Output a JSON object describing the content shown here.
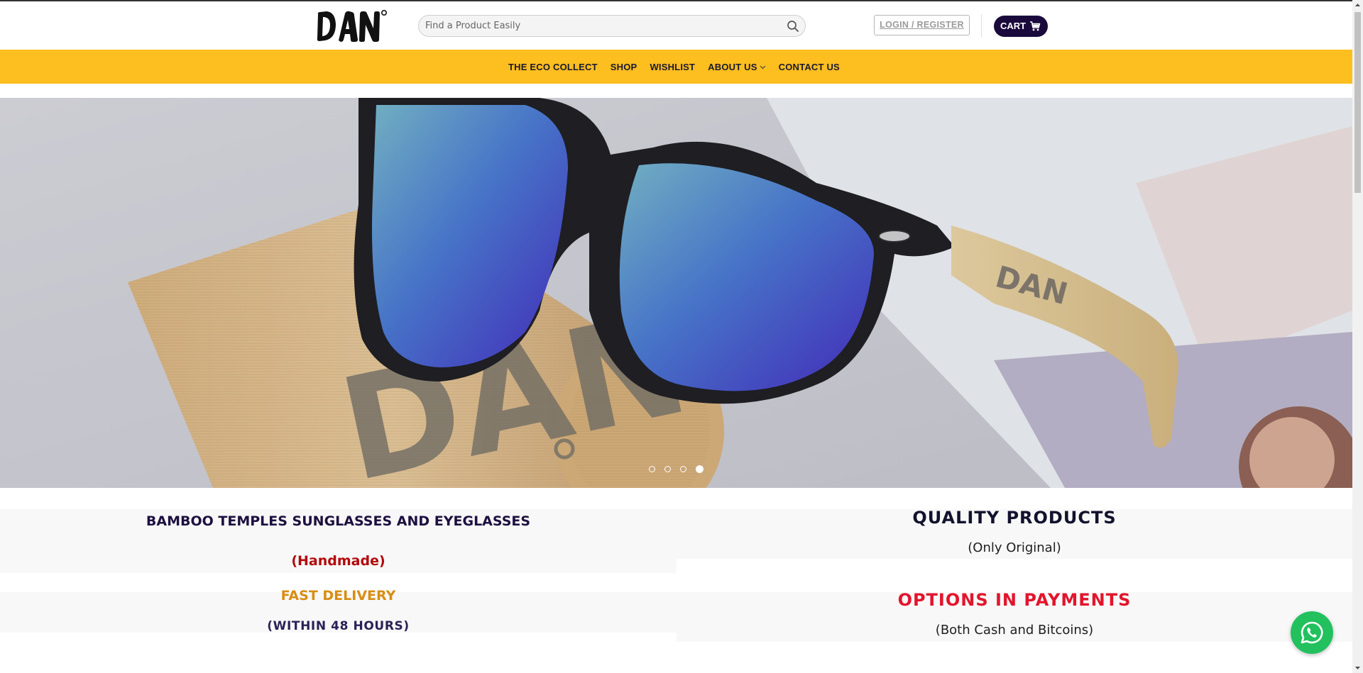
{
  "header": {
    "logo_text": "DAN°",
    "search": {
      "placeholder": "Find a Product Easily",
      "icon": "search-icon"
    },
    "login_label": "LOGIN / REGISTER",
    "cart_label": "CART",
    "cart_icon": "cart-icon"
  },
  "nav": {
    "items": [
      {
        "label": "THE ECO COLLECT"
      },
      {
        "label": "SHOP"
      },
      {
        "label": "WISHLIST"
      },
      {
        "label": "ABOUT US",
        "icon": "chevron-down-icon"
      },
      {
        "label": "CONTACT US"
      }
    ]
  },
  "hero": {
    "image_logo_text": "DAN°",
    "slides_count": 4,
    "active_slide": 4
  },
  "features": {
    "left": {
      "title": "BAMBOO TEMPLES SUNGLASSES AND EYEGLASSES",
      "subtitle": "(Handmade)",
      "delivery_title": "FAST DELIVERY",
      "delivery_subtitle": "(WITHIN 48 HOURS)"
    },
    "right": {
      "quality_title": "QUALITY PRODUCTS",
      "quality_subtitle": "(Only Original)",
      "payments_title": "OPTIONS IN PAYMENTS",
      "payments_subtitle": "(Both Cash and Bitcoins)"
    }
  },
  "colors": {
    "nav_bg": "#fdbe1f",
    "cart_bg": "#1a0a3c",
    "whatsapp": "#22c15e",
    "handmade_red": "#b3090a",
    "delivery_orange": "#d88d14",
    "payments_red": "#e2152c"
  },
  "floating": {
    "whatsapp_icon": "whatsapp-icon"
  }
}
